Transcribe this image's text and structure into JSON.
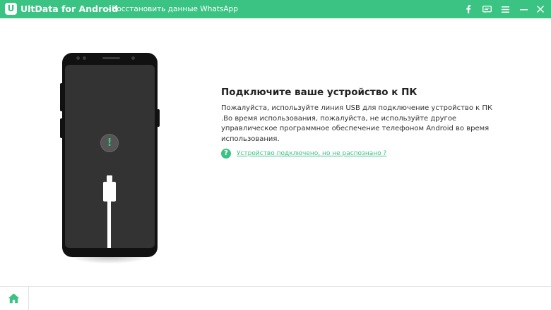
{
  "titlebar": {
    "app_name": "UltData for Android",
    "subtitle": "- Восстановить данные WhatsApp",
    "logo_letter": "U",
    "buttons": [
      "facebook-icon",
      "feedback-icon",
      "menu-icon",
      "minimize-icon",
      "close-icon"
    ]
  },
  "main": {
    "heading": "Подключите ваше устройство к ПК",
    "description": "Пожалуйста, используйте линия USB для подключение устройство к ПК .Во время использования, пожалуйста, не используйте другое управлическое программное обеспечение телефоном Android во время использования.",
    "help_icon_glyph": "?",
    "help_link": "Устройство подключено, но не распознано ?",
    "phone_alert_glyph": "!"
  },
  "footer": {
    "home_icon": "home-icon"
  },
  "colors": {
    "accent": "#3ac382",
    "phone_body": "#111111",
    "phone_screen": "#333333"
  }
}
